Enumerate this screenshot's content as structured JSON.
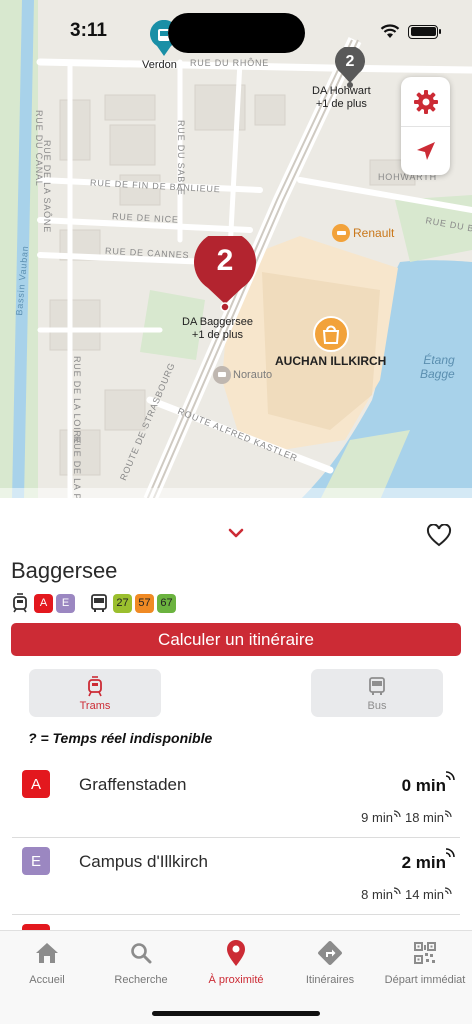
{
  "status_bar": {
    "time": "3:11"
  },
  "map": {
    "streets": {
      "rue_du_rhone": "RUE DU RHÔNE",
      "rue_du_canal": "RUE DU CANAL",
      "rue_de_la_saone": "RUE DE LA SAÔNE",
      "rue_du_sable": "RUE DU SABLE",
      "rue_de_fin_de_banlieue": "RUE DE FIN DE BANLIEUE",
      "rue_de_nice": "RUE DE NICE",
      "rue_de_cannes": "RUE DE CANNES",
      "rue_du_berry": "RUE DU BERRY",
      "rue_de_la_loire": "RUE DE LA LOIRE",
      "rue_de_la_plaine": "RUE DE LA PLAINE",
      "route_de_strasbourg": "ROUTE DE STRASBOURG",
      "route_alfred_kastler": "ROUTE ALFRED KASTLER",
      "bassin_vauban": "Bassin Vauban",
      "hohwarth": "HOHWARTH"
    },
    "water": {
      "line1": "Étang",
      "line2": "Bagge"
    },
    "pois": {
      "renault": "Renault",
      "norauto": "Norauto",
      "auchan": "AUCHAN ILLKIRCH"
    },
    "markers": {
      "verdon": {
        "label": "Verdon",
        "color": "#1a8fa6"
      },
      "hohwart": {
        "count": "2",
        "name": "DA Hohwart",
        "more": "+1 de plus",
        "color": "#595959"
      },
      "baggersee": {
        "count": "2",
        "name": "DA Baggersee",
        "more": "+1 de plus",
        "color": "#b3242f"
      }
    },
    "controls": {
      "settings_icon": "gear-icon",
      "locate_icon": "location-arrow-icon"
    }
  },
  "stop": {
    "name": "Baggersee",
    "tram_lines": [
      {
        "code": "A",
        "color": "#e3181e"
      },
      {
        "code": "E",
        "color": "#9b87c1"
      }
    ],
    "bus_lines": [
      {
        "code": "27",
        "color": "#9bbf2e"
      },
      {
        "code": "57",
        "color": "#f08a24"
      },
      {
        "code": "67",
        "color": "#6bb33f"
      }
    ],
    "route_button": "Calculer un itinéraire",
    "favorite_icon": "heart-outline-icon",
    "collapse_icon": "chevron-down-icon"
  },
  "mode_tabs": {
    "trams": "Trams",
    "bus": "Bus",
    "active": "trams"
  },
  "realtime_note": "? = Temps réel indisponible",
  "departures": [
    {
      "line": "A",
      "line_color": "#e3181e",
      "destination": "Graffenstaden",
      "next": "0 min",
      "later": [
        "9 min",
        "18 min"
      ]
    },
    {
      "line": "E",
      "line_color": "#9b87c1",
      "destination": "Campus d'Illkirch",
      "next": "2 min",
      "later": [
        "8 min",
        "14 min"
      ]
    },
    {
      "line": "",
      "line_color": "#e3181e",
      "destination": "",
      "next": "",
      "later": []
    }
  ],
  "tabbar": {
    "items": [
      {
        "label": "Accueil",
        "icon": "home-icon"
      },
      {
        "label": "Recherche",
        "icon": "search-icon"
      },
      {
        "label": "À proximité",
        "icon": "location-pin-icon"
      },
      {
        "label": "Itinéraires",
        "icon": "directions-icon"
      },
      {
        "label": "Départ immédiat",
        "icon": "qr-code-icon"
      }
    ],
    "active": "À proximité",
    "accent": "#cc2b35"
  }
}
